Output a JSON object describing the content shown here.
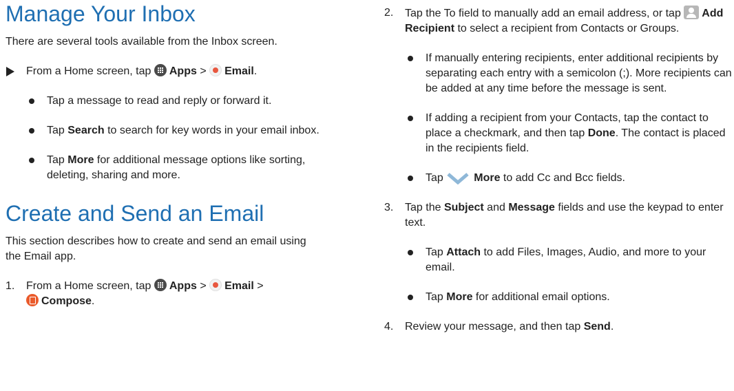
{
  "left": {
    "heading1": "Manage Your Inbox",
    "intro1": "There are several tools available from the Inbox screen.",
    "step_intro": {
      "prefix": "From a Home screen, tap",
      "apps": "Apps",
      "sep": ">",
      "email": "Email",
      "end": "."
    },
    "bullets1": [
      {
        "text": "Tap a message to read and reply or forward it."
      },
      {
        "pre": "Tap ",
        "bold": "Search",
        "post": " to search for key words in your email inbox."
      },
      {
        "pre": "Tap ",
        "bold": "More",
        "post": " for additional message options like sorting, deleting, sharing and more."
      }
    ],
    "heading2": "Create and Send an Email",
    "intro2": "This section describes how to create and send an email using the Email app.",
    "step1": {
      "num": "1.",
      "prefix": "From a Home screen, tap",
      "apps": "Apps",
      "sep1": ">",
      "email": "Email",
      "sep2": ">",
      "compose": "Compose",
      "end": "."
    }
  },
  "right": {
    "step2": {
      "num": "2.",
      "pre": "Tap the To field to manually add an email address, or tap",
      "bold": "Add Recipient",
      "post": " to select a recipient from Contacts or Groups."
    },
    "bullets2": [
      {
        "text": "If manually entering recipients, enter additional recipients by separating each entry with a semicolon (;). More recipients can be added at any time before the message is sent."
      },
      {
        "pre": "If adding a recipient from your Contacts, tap the contact to place a checkmark, and then tap ",
        "bold": "Done",
        "post": ". The contact is placed in the recipients field."
      },
      {
        "pre": "Tap",
        "bold": "More",
        "post": " to add Cc and Bcc fields."
      }
    ],
    "step3": {
      "num": "3.",
      "pre": "Tap the ",
      "bold1": "Subject",
      "mid": " and ",
      "bold2": "Message",
      "post": " fields and use the keypad to enter text."
    },
    "bullets3": [
      {
        "pre": "Tap ",
        "bold": "Attach",
        "post": " to add Files, Images, Audio, and more to your email."
      },
      {
        "pre": "Tap ",
        "bold": "More",
        "post": " for additional email options."
      }
    ],
    "step4": {
      "num": "4.",
      "pre": "Review your message, and then tap ",
      "bold": "Send",
      "end": "."
    }
  },
  "icons": {
    "apps": "apps-grid-icon",
    "email": "email-app-icon",
    "compose": "compose-icon",
    "add_recipient": "person-icon",
    "more": "chevron-down-icon"
  },
  "colors": {
    "heading": "#1f6fb2",
    "compose_icon": "#ea5b2c",
    "email_icon_dot": "#e8573f",
    "chevron": "#8fb8d8"
  }
}
